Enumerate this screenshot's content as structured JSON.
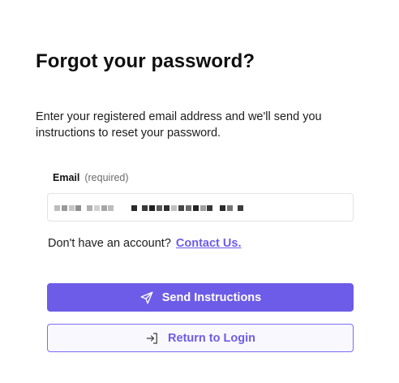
{
  "page": {
    "title": "Forgot your password?",
    "description": "Enter your registered email address and we'll send you instructions to reset your password."
  },
  "email_field": {
    "label": "Email",
    "required_note": "(required)"
  },
  "account": {
    "prompt": "Don't have an account?",
    "contact_link": "Contact Us."
  },
  "buttons": {
    "send": "Send Instructions",
    "return": "Return to Login"
  },
  "colors": {
    "accent": "#6c5ce7",
    "secondary_bg": "#faf8ff"
  },
  "icons": {
    "send": "paper-plane-icon",
    "return": "login-arrow-icon"
  }
}
